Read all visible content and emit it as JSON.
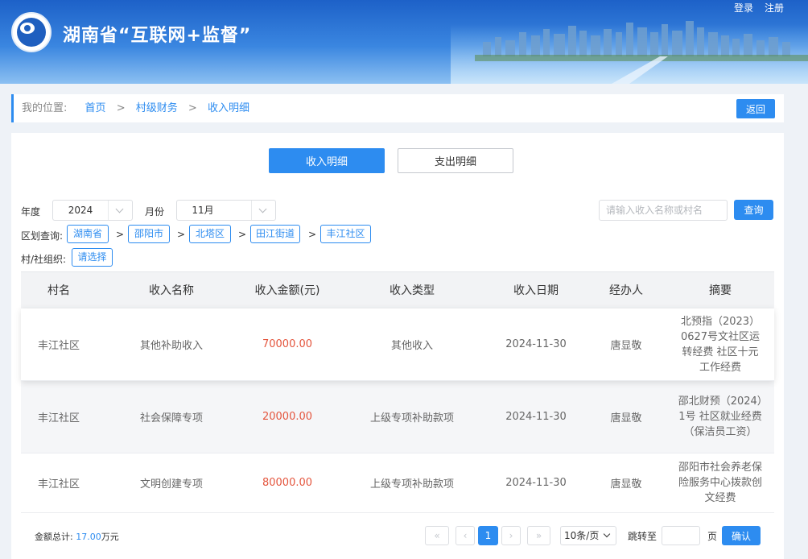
{
  "header": {
    "title": "湖南省“互联网+监督”",
    "login": "登录",
    "register": "注册"
  },
  "breadcrumb": {
    "prefix": "我的位置:",
    "home": "首页",
    "sep": ">",
    "level1": "村级财务",
    "current": "收入明细",
    "back": "返回"
  },
  "tabs": {
    "income": "收入明细",
    "expense": "支出明细"
  },
  "filters": {
    "year_label": "年度",
    "year_value": "2024",
    "month_label": "月份",
    "month_value": "11月",
    "search_placeholder": "请输入收入名称或村名",
    "query": "查询",
    "region_label": "区划查询:",
    "regions": [
      "湖南省",
      "邵阳市",
      "北塔区",
      "田江街道",
      "丰江社区"
    ],
    "org_label": "村/社组织:",
    "org_button": "请选择"
  },
  "table": {
    "headers": [
      "村名",
      "收入名称",
      "收入金额(元)",
      "收入类型",
      "收入日期",
      "经办人",
      "摘要"
    ],
    "rows": [
      {
        "village": "丰江社区",
        "name": "其他补助收入",
        "amount": "70000.00",
        "type": "其他收入",
        "date": "2024-11-30",
        "handler": "唐显敬",
        "memo": "北预指（2023）0627号文社区运转经费 社区十元工作经费"
      },
      {
        "village": "丰江社区",
        "name": "社会保障专项",
        "amount": "20000.00",
        "type": "上级专项补助款项",
        "date": "2024-11-30",
        "handler": "唐显敬",
        "memo": "邵北财预（2024）1号 社区就业经费（保洁员工资）"
      },
      {
        "village": "丰江社区",
        "name": "文明创建专项",
        "amount": "80000.00",
        "type": "上级专项补助款项",
        "date": "2024-11-30",
        "handler": "唐显敬",
        "memo": "邵阳市社会养老保险服务中心拨款创文经费"
      }
    ]
  },
  "footer": {
    "total_label": "金额总计:",
    "total_value": "17.00",
    "total_unit": "万元",
    "first": "«",
    "prev": "‹",
    "page": "1",
    "next": "›",
    "last": "»",
    "page_size": "10条/页",
    "jump_label": "跳转至",
    "page_unit": "页",
    "confirm": "确认"
  },
  "colors": {
    "primary": "#2d8cf0",
    "amount": "#e4553d",
    "header_top": "#1d61c8"
  }
}
